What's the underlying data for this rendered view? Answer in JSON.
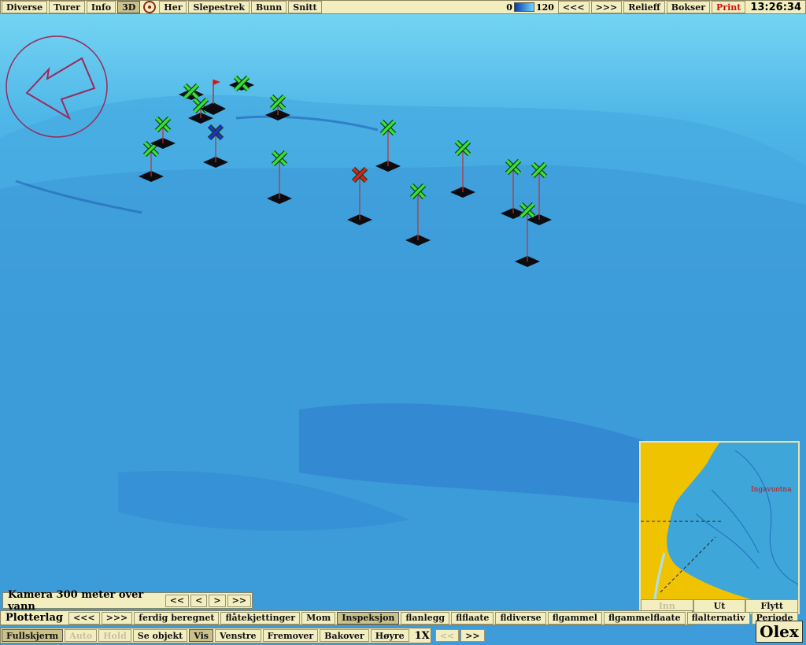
{
  "topbar": {
    "left_buttons": [
      "Diverse",
      "Turer",
      "Info",
      "3D"
    ],
    "mid_buttons": [
      "Her",
      "Slepestrek",
      "Bunn",
      "Snitt"
    ],
    "depth_min": "0",
    "depth_max": "120",
    "right_buttons": [
      "<<<",
      ">>>",
      "Relieff",
      "Bokser"
    ],
    "print_label": "Print",
    "clock": "13:26:34"
  },
  "camera": {
    "title": "Kamera 300 meter over vann",
    "nav": [
      "<<",
      "<",
      ">",
      ">>"
    ]
  },
  "plotter": {
    "label": "Plotterlag",
    "nav": [
      "<<<",
      ">>>"
    ],
    "layers": [
      "ferdig beregnet",
      "flåtekjettinger",
      "Mom",
      "Inspeksjon",
      "flanlegg",
      "flflaate",
      "fldiverse",
      "flgammel",
      "flgammelflaate",
      "flalternativ",
      "Periode"
    ],
    "active_layer_index": 3
  },
  "bottom": {
    "buttons": [
      "Fullskjerm",
      "Auto",
      "Hold",
      "Se objekt",
      "Vis",
      "Venstre",
      "Fremover",
      "Bakover",
      "Høyre"
    ],
    "disabled": [
      1,
      2
    ],
    "active": [
      0,
      4
    ],
    "speed": "1X",
    "speed_nav": [
      "<<",
      ">>"
    ]
  },
  "inset": {
    "place_name": "Ingavuotna",
    "buttons": [
      "Inn",
      "Ut",
      "Flytt"
    ]
  },
  "brand": "Olex",
  "markers": {
    "green": "#38e038",
    "blue": "#2030d0",
    "red": "#e02020",
    "flag": "#e01010"
  },
  "colors": {
    "sea_light": "#5fc6ec",
    "sea_mid": "#3a9ad6",
    "sea_deep": "#1f62c8",
    "land": "#f0c300",
    "toolbar": "#f3eec0"
  }
}
